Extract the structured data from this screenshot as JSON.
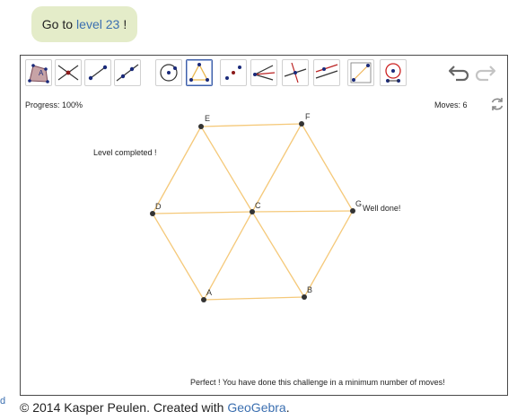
{
  "goto": {
    "prefix": "Go to",
    "link": "level 23",
    "suffix": "!"
  },
  "toolbar": {
    "tools": [
      {
        "name": "polygon-tool-icon"
      },
      {
        "name": "intersect-tool-icon"
      },
      {
        "name": "segment-tool-icon"
      },
      {
        "name": "line-tool-icon"
      },
      {
        "name": "circle-tool-icon"
      },
      {
        "name": "triangle-tool-icon",
        "active": true
      },
      {
        "name": "midpoint-tool-icon"
      },
      {
        "name": "angle-bisector-tool-icon"
      },
      {
        "name": "perpendicular-tool-icon"
      },
      {
        "name": "parallel-tool-icon"
      },
      {
        "name": "reflect-tool-icon"
      },
      {
        "name": "compass-tool-icon"
      }
    ]
  },
  "status": {
    "progress": "Progress: 100%",
    "moves": "Moves: 6"
  },
  "messages": {
    "level_completed": "Level completed !",
    "well_done": "Well done!",
    "perfect": "Perfect ! You have done this challenge in a minimum number of moves!"
  },
  "points": {
    "A": "A",
    "B": "B",
    "C": "C",
    "D": "D",
    "E": "E",
    "F": "F",
    "G": "G"
  },
  "colors": {
    "segment": "#f5c97a",
    "point": "#333333",
    "goto_bg": "#e4ecc9",
    "link": "#3b6fb0"
  },
  "footer": {
    "text": "© 2014 Kasper Peulen. Created with",
    "link": "GeoGebra",
    "end": "."
  },
  "edge_text": "d"
}
